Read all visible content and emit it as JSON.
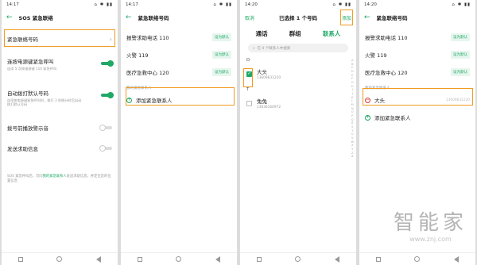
{
  "phone1": {
    "status": {
      "time": "14:17",
      "icons": "⌂ ✱ ▮▮"
    },
    "title": "SOS 紧急联络",
    "rows": [
      {
        "label": "紧急联络号码"
      },
      {
        "label": "连按电源键紧急呼叫",
        "sub": "连续 5 次按电源键 110 紧急呼叫"
      },
      {
        "label": "自动拨打默认号码",
        "sub": "连续按电源键紧急呼叫时，拨打 3 秒倒计时后自动拨打默认号码"
      },
      {
        "label": "拨号前播放警示音"
      },
      {
        "label": "发送求助信息"
      }
    ],
    "note_prefix": "SOS 紧急呼叫后，可向",
    "note_link": "我的紧急联系人",
    "note_suffix": "发送求助信息，并定位您的位置信息"
  },
  "phone2": {
    "status": {
      "time": "14:17",
      "icons": "⌂ ✱ ▮▮"
    },
    "title": "紧急联络号码",
    "defaults": [
      {
        "name": "报警求助电话 110",
        "badge": "设为默认"
      },
      {
        "name": "火警 119",
        "badge": "设为默认"
      },
      {
        "name": "医疗急救中心 120",
        "badge": "设为默认"
      }
    ],
    "section": "我的紧急联系人",
    "add_label": "添加紧急联系人"
  },
  "phone3": {
    "status": {
      "time": "14:20",
      "icons": "⌂ ✱ ▮▮"
    },
    "cancel": "取消",
    "selected": "已选择 1 个号码",
    "add": "添加",
    "tabs": [
      "通话",
      "群组",
      "联系人"
    ],
    "search_placeholder": "在 0 个联系人中搜索",
    "groups": [
      {
        "letter": "D",
        "name": "大头",
        "number": "13609631220",
        "checked": true
      },
      {
        "letter": "T",
        "name": "兔兔",
        "number": "13636160972",
        "checked": false
      }
    ],
    "alphabet": [
      "A",
      "B",
      "C",
      "D",
      "E",
      "F",
      "G",
      "H",
      "I",
      "J",
      "K",
      "L",
      "M",
      "N",
      "O",
      "P",
      "Q",
      "R",
      "S",
      "T",
      "U",
      "V",
      "W",
      "X",
      "Y",
      "Z",
      "#"
    ]
  },
  "phone4": {
    "status": {
      "time": "14:20",
      "icons": "⌂ ✱ ▮▮"
    },
    "title": "紧急联络号码",
    "defaults": [
      {
        "name": "报警求助电话 110",
        "badge": "设为默认"
      },
      {
        "name": "火警 119",
        "badge": "设为默认"
      },
      {
        "name": "医疗急救中心 120",
        "badge": "设为默认"
      }
    ],
    "section": "我的紧急联系人",
    "contact": {
      "name": "大头",
      "number": "13609631220"
    },
    "add_label": "添加紧急联系人"
  },
  "watermark": {
    "brand": "智能家",
    "url": "www.znj.com"
  },
  "colors": {
    "accent": "#1fa866",
    "highlight": "#f29b21",
    "danger": "#e03a3a"
  }
}
